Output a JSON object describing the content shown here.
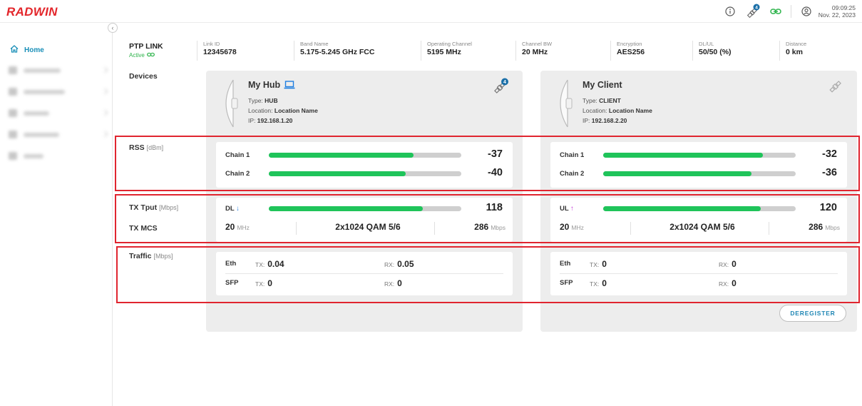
{
  "app": {
    "logo": "RADWIN"
  },
  "topbar": {
    "time": "09:09:25",
    "date": "Nov. 22, 2023",
    "satellite_badge": "4"
  },
  "sidebar": {
    "home_label": "Home",
    "collapse_glyph": "‹"
  },
  "link": {
    "title": "PTP LINK",
    "status": "Active",
    "fields": [
      {
        "label": "Link ID",
        "value": "12345678"
      },
      {
        "label": "Band Name",
        "value": "5.175-5.245 GHz FCC"
      },
      {
        "label": "Operating Channel",
        "value": "5195 MHz"
      },
      {
        "label": "Channel BW",
        "value": "20 MHz"
      },
      {
        "label": "Encryption",
        "value": "AES256"
      },
      {
        "label": "DL/UL",
        "value": "50/50 (%)"
      },
      {
        "label": "Distance",
        "value": "0 km"
      }
    ]
  },
  "sections": {
    "devices": "Devices",
    "rss": "RSS",
    "rss_unit": "[dBm]",
    "tx_tput": "TX Tput",
    "tx_tput_unit": "[Mbps]",
    "tx_mcs": "TX MCS",
    "traffic": "Traffic",
    "traffic_unit": "[Mbps]"
  },
  "hub": {
    "name": "My Hub",
    "type_label": "Type:",
    "type": "HUB",
    "location_label": "Location:",
    "location": "Location Name",
    "ip_label": "IP:",
    "ip": "192.168.1.20",
    "satellite_badge": "4",
    "rss": [
      {
        "label": "Chain 1",
        "value": "-37",
        "fill": 0.75
      },
      {
        "label": "Chain 2",
        "value": "-40",
        "fill": 0.71
      }
    ],
    "tput": {
      "label": "DL",
      "arrow": "↓",
      "arrow_color": "#1e7ee0",
      "value": "118",
      "fill": 0.8
    },
    "mcs": {
      "bw": "20",
      "bw_unit": "MHz",
      "modulation": "2x1024 QAM 5/6",
      "rate": "286",
      "rate_unit": "Mbps"
    },
    "traffic": {
      "eth": {
        "label": "Eth",
        "tx_label": "TX:",
        "tx": "0.04",
        "rx_label": "RX:",
        "rx": "0.05"
      },
      "sfp": {
        "label": "SFP",
        "tx_label": "TX:",
        "tx": "0",
        "rx_label": "RX:",
        "rx": "0"
      }
    }
  },
  "client": {
    "name": "My Client",
    "type_label": "Type:",
    "type": "CLIENT",
    "location_label": "Location:",
    "location": "Location Name",
    "ip_label": "IP:",
    "ip": "192.168.2.20",
    "rss": [
      {
        "label": "Chain 1",
        "value": "-32",
        "fill": 0.83
      },
      {
        "label": "Chain 2",
        "value": "-36",
        "fill": 0.77
      }
    ],
    "tput": {
      "label": "UL",
      "arrow": "↑",
      "arrow_color": "#c23bd6",
      "value": "120",
      "fill": 0.82
    },
    "mcs": {
      "bw": "20",
      "bw_unit": "MHz",
      "modulation": "2x1024 QAM 5/6",
      "rate": "286",
      "rate_unit": "Mbps"
    },
    "traffic": {
      "eth": {
        "label": "Eth",
        "tx_label": "TX:",
        "tx": "0",
        "rx_label": "RX:",
        "rx": "0"
      },
      "sfp": {
        "label": "SFP",
        "tx_label": "TX:",
        "tx": "0",
        "rx_label": "RX:",
        "rx": "0"
      }
    }
  },
  "actions": {
    "deregister": "DEREGISTER"
  },
  "colors": {
    "brand": "#e3262b",
    "accent": "#1a8fb8",
    "bar_fill": "#1fc45a",
    "highlight": "#e0252f",
    "active": "#2cb34a"
  }
}
